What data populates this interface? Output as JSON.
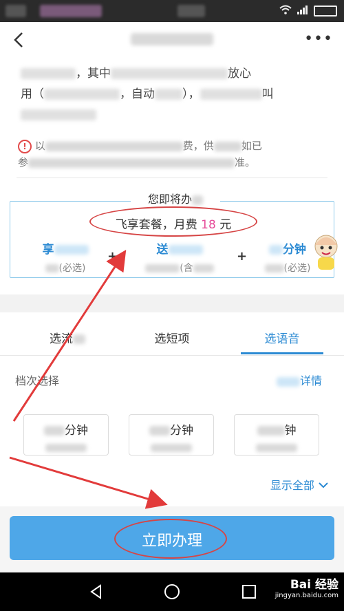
{
  "header": {
    "back_icon": "chevron-left-icon",
    "more_label": "•••"
  },
  "description": {
    "line1_text1": "，其中",
    "line1_text2": "放心",
    "line2_text1": "用（",
    "line2_text2": "，自动",
    "line2_text3": "），",
    "line2_text4": "叫"
  },
  "notice": {
    "text_start": "以",
    "text_mid": "费，供",
    "text_end": "如已",
    "line2_start": "参",
    "line2_end": "准。"
  },
  "plan": {
    "heading": "您即将办",
    "summary_text": "飞享套餐，月费 ",
    "summary_price": "18",
    "summary_unit": " 元",
    "options": [
      {
        "name": "享",
        "sub": "(必选)"
      },
      {
        "name": "送",
        "sub": "(含"
      },
      {
        "name": "分钟",
        "sub": "(必选)"
      }
    ],
    "plus": "+"
  },
  "tabs": [
    {
      "label": "选流",
      "active": false
    },
    {
      "label": "选短",
      "suffix": "项",
      "active": false
    },
    {
      "label": "选语音",
      "active": true
    }
  ],
  "tier_section": {
    "title": "档次选择",
    "detail_link": "详情",
    "tiers": [
      {
        "label": "分钟"
      },
      {
        "label": "分钟"
      },
      {
        "label": "钟"
      }
    ],
    "show_all": "显示全部"
  },
  "cta": {
    "label": "立即办理"
  },
  "watermark": {
    "brand": "Bai 经验",
    "url": "jingyan.baidu.com"
  },
  "colors": {
    "accent": "#2b8ad3",
    "cta": "#4ea7e8",
    "price": "#e64d9a",
    "annotation": "#d64545"
  }
}
